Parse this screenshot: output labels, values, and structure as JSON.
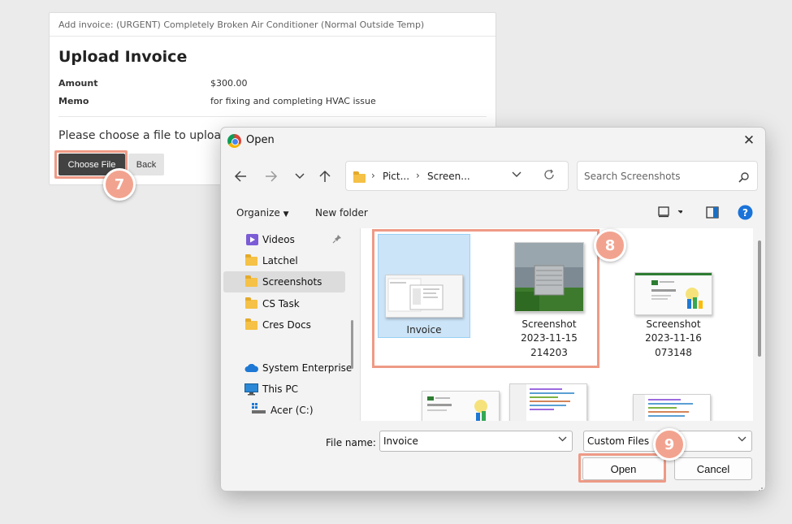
{
  "page": {
    "header": "Add invoice: (URGENT) Completely Broken Air Conditioner (Normal Outside Temp)",
    "title": "Upload Invoice",
    "fields": [
      {
        "label": "Amount",
        "value": "$300.00"
      },
      {
        "label": "Memo",
        "value": "for fixing and completing HVAC issue"
      }
    ],
    "upload_prompt": "Please choose a file to upload.",
    "choose_file_label": "Choose File",
    "back_label": "Back"
  },
  "steps": [
    "7",
    "8",
    "9"
  ],
  "dialog": {
    "title": "Open",
    "breadcrumb": [
      "Pict...",
      "Screen..."
    ],
    "search_placeholder": "Search Screenshots",
    "organize_label": "Organize",
    "new_folder_label": "New folder",
    "help_label": "?",
    "nav_items": [
      {
        "label": "Videos",
        "icon": "video-icon",
        "pinned": true
      },
      {
        "label": "Latchel",
        "icon": "folder-icon"
      },
      {
        "label": "Screenshots",
        "icon": "folder-icon",
        "selected": true
      },
      {
        "label": "CS Task",
        "icon": "folder-icon"
      },
      {
        "label": "Cres Docs",
        "icon": "folder-icon"
      },
      {
        "label": "System Enterprise",
        "icon": "cloud-icon"
      },
      {
        "label": "This PC",
        "icon": "pc-icon"
      },
      {
        "label": "Acer (C:)",
        "icon": "drive-icon"
      }
    ],
    "files": [
      {
        "lines": [
          "Invoice"
        ],
        "selected": true
      },
      {
        "lines": [
          "Screenshot",
          "2023-11-15",
          "214203"
        ]
      },
      {
        "lines": [
          "Screenshot",
          "2023-11-16",
          "073148"
        ]
      }
    ],
    "file_name_label": "File name:",
    "file_name_value": "Invoice",
    "file_type_value": "Custom Files",
    "open_label": "Open",
    "cancel_label": "Cancel"
  },
  "colors": {
    "highlight": "#ee9a86",
    "badge": "#f2a38f",
    "selection": "#cce4f7",
    "primary_dark": "#424242"
  }
}
